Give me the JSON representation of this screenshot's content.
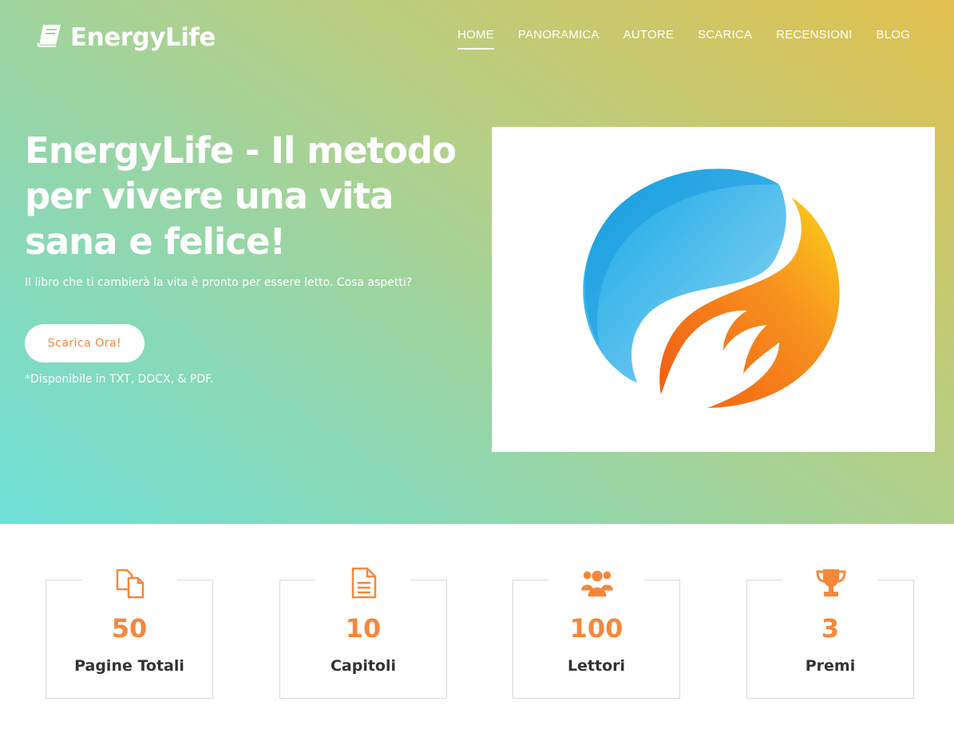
{
  "brand": {
    "name": "EnergyLife",
    "icon": "book-icon"
  },
  "nav": {
    "items": [
      {
        "label": "HOME",
        "active": true
      },
      {
        "label": "PANORAMICA",
        "active": false
      },
      {
        "label": "AUTORE",
        "active": false
      },
      {
        "label": "SCARICA",
        "active": false
      },
      {
        "label": "RECENSIONI",
        "active": false
      },
      {
        "label": "BLOG",
        "active": false
      }
    ]
  },
  "hero": {
    "title": "EnergyLife - Il metodo per vivere una vita sana e felice!",
    "subtitle": "Il libro che ti cambierà la vita è pronto per essere letto. Cosa aspetti?",
    "cta_label": "Scarica Ora!",
    "availability": "*Disponibile in TXT, DOCX, & PDF."
  },
  "colors": {
    "accent": "#f6873a",
    "blue": "#1aa3e8",
    "orange": "#f7a21b"
  },
  "stats": [
    {
      "icon": "copy-icon",
      "value": "50",
      "label": "Pagine Totali"
    },
    {
      "icon": "document-icon",
      "value": "10",
      "label": "Capitoli"
    },
    {
      "icon": "users-icon",
      "value": "100",
      "label": "Lettori"
    },
    {
      "icon": "trophy-icon",
      "value": "3",
      "label": "Premi"
    }
  ]
}
